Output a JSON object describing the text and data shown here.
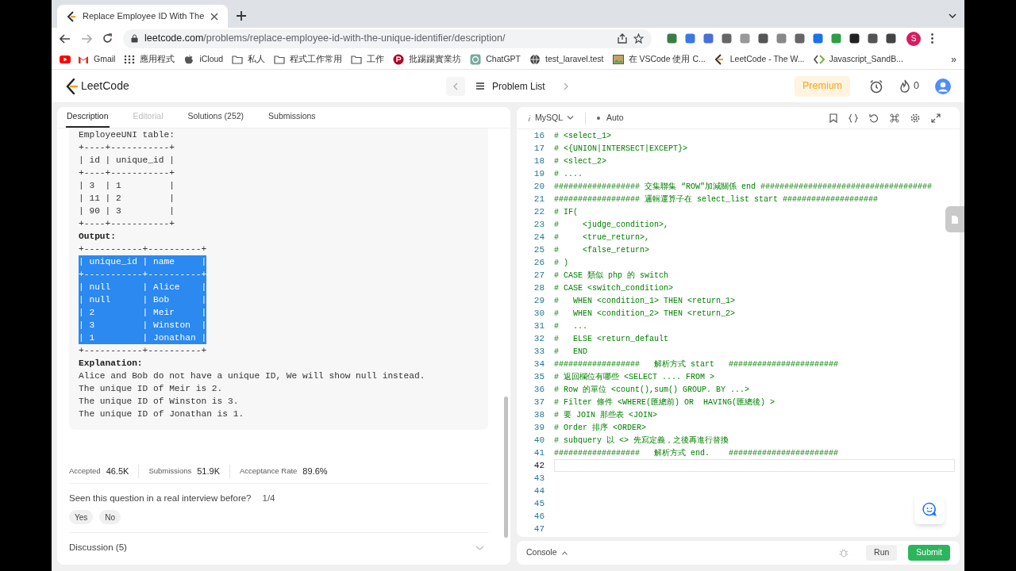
{
  "browser": {
    "tab_title": "Replace Employee ID With The",
    "url_host": "leetcode.com",
    "url_path": "/problems/replace-employee-id-with-the-unique-identifier/description/",
    "profile_initial": "S",
    "bookmarks": [
      {
        "kind": "youtube"
      },
      {
        "kind": "gmail",
        "label": "Gmail"
      },
      {
        "kind": "apps",
        "label": "應用程式"
      },
      {
        "kind": "apple",
        "label": "iCloud"
      },
      {
        "kind": "folder",
        "label": "私人"
      },
      {
        "kind": "folder",
        "label": "程式工作常用"
      },
      {
        "kind": "folder",
        "label": "工作"
      },
      {
        "kind": "ptt",
        "label": "批踢踢實業坊"
      },
      {
        "kind": "chatgpt",
        "label": "ChatGPT"
      },
      {
        "kind": "globe",
        "label": "test_laravel.test"
      },
      {
        "kind": "image",
        "label": "在 VSCode 使用 C..."
      },
      {
        "kind": "leetcode",
        "label": "LeetCode - The W..."
      },
      {
        "kind": "code",
        "label": "Javascript_SandB..."
      }
    ],
    "more_bookmarks": "»"
  },
  "header": {
    "logo": "LeetCode",
    "problem_list": "Problem List",
    "premium": "Premium",
    "streak": "0"
  },
  "description_tabs": [
    {
      "label": "Description",
      "selected": true,
      "disabled": false
    },
    {
      "label": "Editorial",
      "selected": false,
      "disabled": true
    },
    {
      "label": "Solutions (252)",
      "selected": false,
      "disabled": false
    },
    {
      "label": "Submissions",
      "selected": false,
      "disabled": false
    }
  ],
  "description_lines": [
    {
      "kind": "text",
      "text": "EmployeeUNI table:",
      "selected": false
    },
    {
      "kind": "text",
      "text": "+----+-----------+",
      "selected": false
    },
    {
      "kind": "text",
      "text": "| id | unique_id |",
      "selected": false
    },
    {
      "kind": "text",
      "text": "+----+-----------+",
      "selected": false
    },
    {
      "kind": "text",
      "text": "| 3  | 1         |",
      "selected": false
    },
    {
      "kind": "text",
      "text": "| 11 | 2         |",
      "selected": false
    },
    {
      "kind": "text",
      "text": "| 90 | 3         |",
      "selected": false
    },
    {
      "kind": "text",
      "text": "+----+-----------+",
      "selected": false
    },
    {
      "kind": "heading",
      "text": "Output:",
      "selected": false
    },
    {
      "kind": "text",
      "text": "+-----------+----------+",
      "selected": false
    },
    {
      "kind": "text",
      "text": "| unique_id | name     |",
      "selected": true
    },
    {
      "kind": "text",
      "text": "+-----------+----------+",
      "selected": true
    },
    {
      "kind": "text",
      "text": "| null      | Alice    |",
      "selected": true
    },
    {
      "kind": "text",
      "text": "| null      | Bob      |",
      "selected": true
    },
    {
      "kind": "text",
      "text": "| 2         | Meir     |",
      "selected": true
    },
    {
      "kind": "text",
      "text": "| 3         | Winston  |",
      "selected": true
    },
    {
      "kind": "text",
      "text": "| 1         | Jonathan |",
      "selected": true
    },
    {
      "kind": "text",
      "text": "+-----------+----------+",
      "selected": false
    },
    {
      "kind": "heading",
      "text": "Explanation:",
      "selected": false
    },
    {
      "kind": "text",
      "text": "Alice and Bob do not have a unique ID, We will show null instead.",
      "selected": false
    },
    {
      "kind": "text",
      "text": "The unique ID of Meir is 2.",
      "selected": false
    },
    {
      "kind": "text",
      "text": "The unique ID of Winston is 3.",
      "selected": false
    },
    {
      "kind": "text",
      "text": "The unique ID of Jonathan is 1.",
      "selected": false
    }
  ],
  "stats": [
    {
      "label": "Accepted",
      "value": "46.5K"
    },
    {
      "label": "Submissions",
      "value": "51.9K"
    },
    {
      "label": "Acceptance Rate",
      "value": "89.6%"
    }
  ],
  "interview": {
    "question": "Seen this question in a real interview before?",
    "count": "1/4",
    "answers": [
      "Yes",
      "No"
    ]
  },
  "discussion": "Discussion (5)",
  "editor": {
    "language": "MySQL",
    "mode": "Auto",
    "lines": [
      {
        "number": "16",
        "text": "# <select_1>",
        "current": false
      },
      {
        "number": "17",
        "text": "# <{UNION|INTERSECT|EXCEPT}>",
        "current": false
      },
      {
        "number": "18",
        "text": "# <slect_2>",
        "current": false
      },
      {
        "number": "19",
        "text": "# ....",
        "current": false
      },
      {
        "number": "20",
        "text": "################## 交集聯集 “ROW\"加減關係 end ####################################",
        "current": false
      },
      {
        "number": "21",
        "text": "################## 邏輯運算子在 select_list start ####################",
        "current": false
      },
      {
        "number": "22",
        "text": "# IF(",
        "current": false
      },
      {
        "number": "23",
        "text": "#     <judge_condition>,",
        "current": false
      },
      {
        "number": "24",
        "text": "#     <true_return>,",
        "current": false
      },
      {
        "number": "25",
        "text": "#     <false_return>",
        "current": false
      },
      {
        "number": "26",
        "text": "# )",
        "current": false
      },
      {
        "number": "27",
        "text": "# CASE 類似 php 的 switch",
        "current": false
      },
      {
        "number": "28",
        "text": "# CASE <switch_condition>",
        "current": false
      },
      {
        "number": "29",
        "text": "#   WHEN <condition_1> THEN <return_1>",
        "current": false
      },
      {
        "number": "30",
        "text": "#   WHEN <condition_2> THEN <return_2>",
        "current": false
      },
      {
        "number": "31",
        "text": "#   ...",
        "current": false
      },
      {
        "number": "32",
        "text": "#   ELSE <return_default",
        "current": false
      },
      {
        "number": "33",
        "text": "#   END",
        "current": false
      },
      {
        "number": "34",
        "text": "##################   解析方式 start   #######################",
        "current": false
      },
      {
        "number": "35",
        "text": "# 返回欄位有哪些 <SELECT .... FROM >",
        "current": false
      },
      {
        "number": "36",
        "text": "# Row 的單位 <count(),sum() GROUP. BY ...>",
        "current": false
      },
      {
        "number": "37",
        "text": "# Filter 條件 <WHERE(匯總前) OR  HAVING(匯總後) >",
        "current": false
      },
      {
        "number": "38",
        "text": "# 要 JOIN 那些表 <JOIN>",
        "current": false
      },
      {
        "number": "39",
        "text": "# Order 排序 <ORDER>",
        "current": false
      },
      {
        "number": "40",
        "text": "# subquery 以 <> 先寫定義，之後再進行替換",
        "current": false
      },
      {
        "number": "41",
        "text": "##################   解析方式 end.    #######################",
        "current": false
      },
      {
        "number": "42",
        "current": true
      },
      {
        "number": "43",
        "current": false
      },
      {
        "number": "44",
        "current": false
      },
      {
        "number": "45",
        "current": false
      },
      {
        "number": "46",
        "current": false
      },
      {
        "number": "47",
        "current": false
      }
    ]
  },
  "console": {
    "label": "Console",
    "buttons": [
      {
        "kind": "secondary",
        "label": "Run"
      },
      {
        "kind": "primary",
        "label": "Submit"
      }
    ]
  }
}
